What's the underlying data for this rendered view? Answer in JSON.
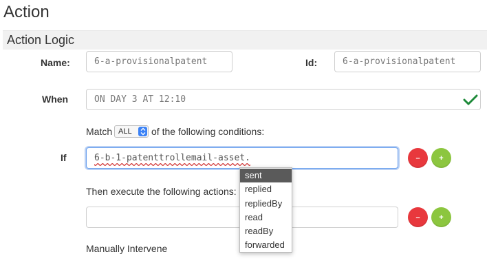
{
  "page": {
    "title": "Action"
  },
  "section": {
    "title": "Action Logic"
  },
  "fields": {
    "name_label": "Name:",
    "name_value": "6-a-provisionalpatent",
    "id_label": "Id:",
    "id_value": "6-a-provisionalpatent",
    "when_label": "When",
    "when_value": "ON DAY 3 AT 12:10"
  },
  "match": {
    "prefix": "Match",
    "selected": "ALL",
    "suffix": "of the following conditions:"
  },
  "condition": {
    "if_label": "If",
    "value": "6-b-1-patenttrollemail-asset.",
    "remove_label": "–",
    "add_label": "+"
  },
  "actions": {
    "heading": "Then execute the following actions:",
    "value": "",
    "remove_label": "–",
    "add_label": "+"
  },
  "manual": {
    "label": "Manually Intervene"
  },
  "autocomplete": {
    "options": [
      "sent",
      "replied",
      "repliedBy",
      "read",
      "readBy",
      "forwarded"
    ],
    "selected": "sent"
  },
  "colors": {
    "valid_check": "#1e8a3a",
    "remove_button": "#e8383d",
    "add_button": "#8cc63f",
    "focus_ring": "#6aa0ee"
  },
  "icons": {
    "valid": "check-icon",
    "select_arrows": "updown-chevron-icon"
  }
}
